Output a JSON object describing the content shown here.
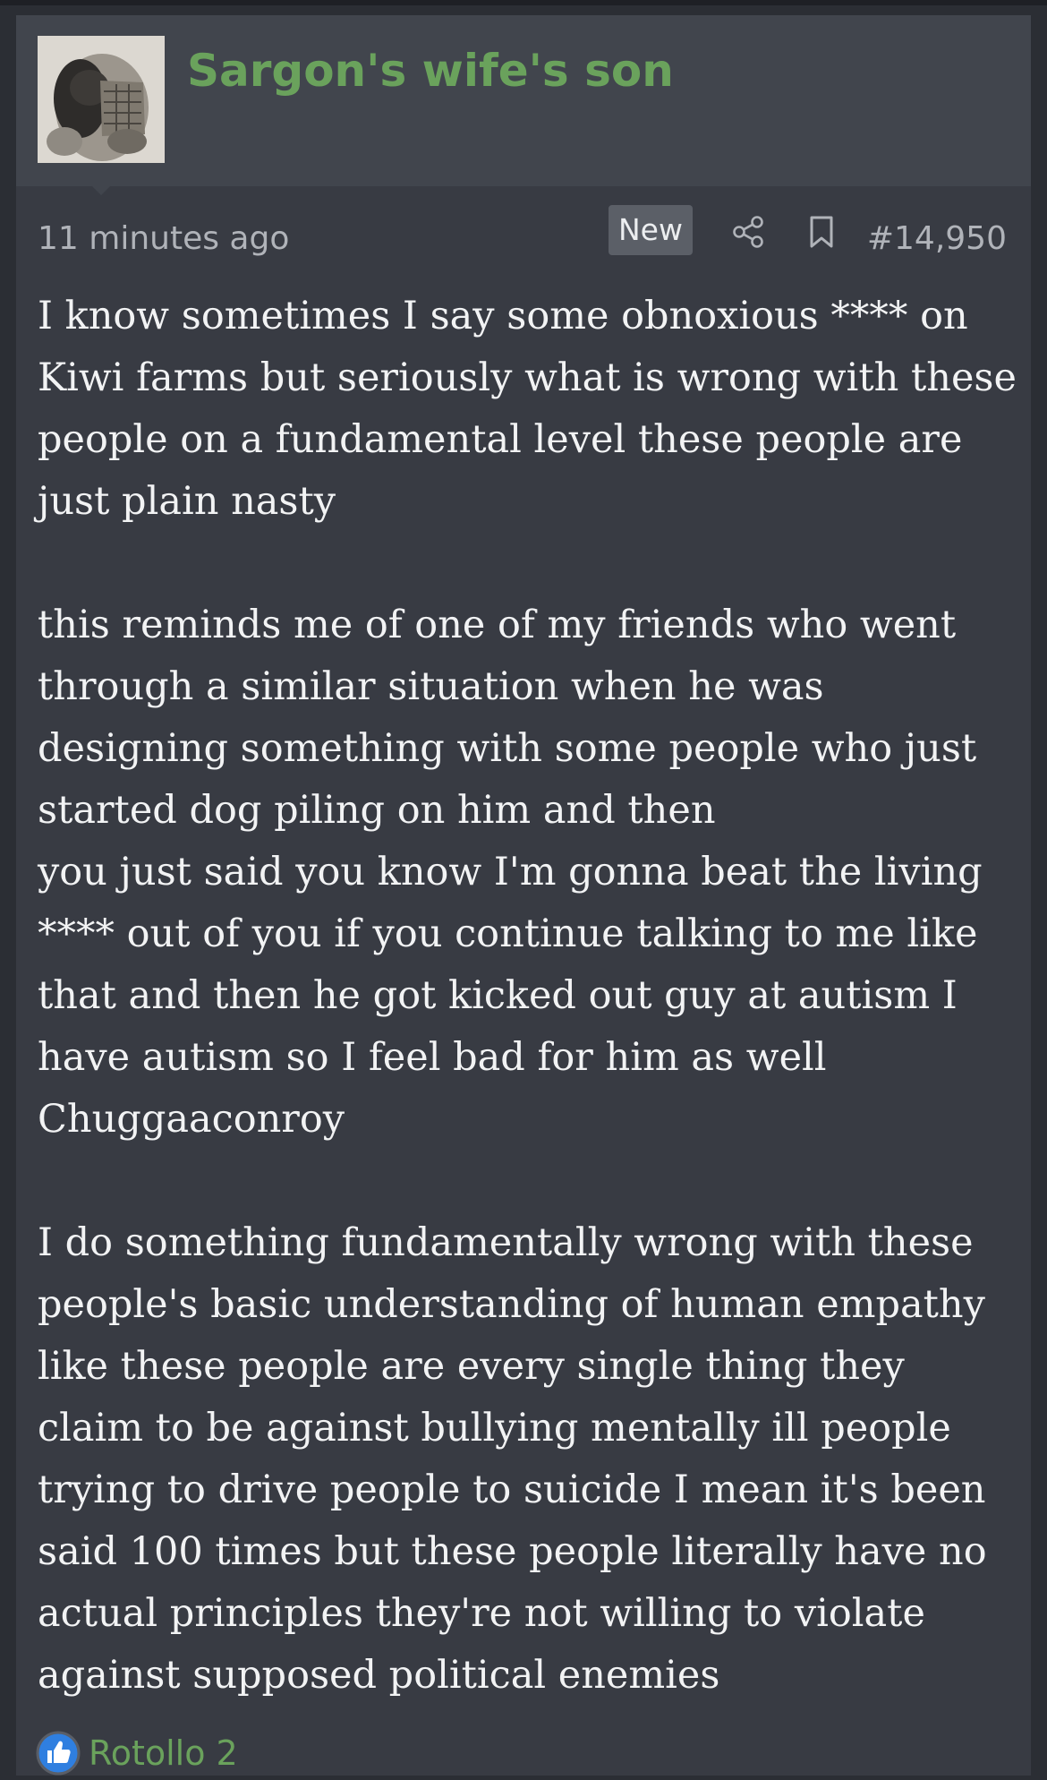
{
  "post": {
    "author": "Sargon's wife's son",
    "time_ago": "11 minutes ago",
    "badge": "New",
    "post_number": "#14,950",
    "icons": {
      "avatar": "ancient-sculpture-avatar",
      "share": "share-icon",
      "bookmark": "bookmark-icon"
    },
    "body": "I know sometimes I say some obnoxious **** on Kiwi farms but seriously what is wrong with these people on a fundamental level these people are just plain nasty\n\nthis reminds me of one of my friends who went through a similar situation when he was designing something with some people who just started dog piling on him and then\nyou just said you know I'm gonna beat the living **** out of you if you continue talking to me like that and then he got kicked out guy at autism I have autism so I feel bad for him as well\nChuggaaconroy\n\nI do something fundamentally wrong with these people's basic understanding of human empathy like these people are every single thing they claim to be against bullying mentally ill people trying to drive people to suicide I mean it's been said 100 times but these people literally have no actual principles they're not willing to violate against supposed political enemies",
    "reactions": {
      "icon": "thumbs-up-icon",
      "text": "Rotollo 2"
    }
  },
  "colors": {
    "username": "#6aa25c",
    "background": "#383b43",
    "header_background": "#41454d",
    "text": "#f2f3f4",
    "meta": "#b0b3b9",
    "like_blue": "#2f7fe0"
  }
}
